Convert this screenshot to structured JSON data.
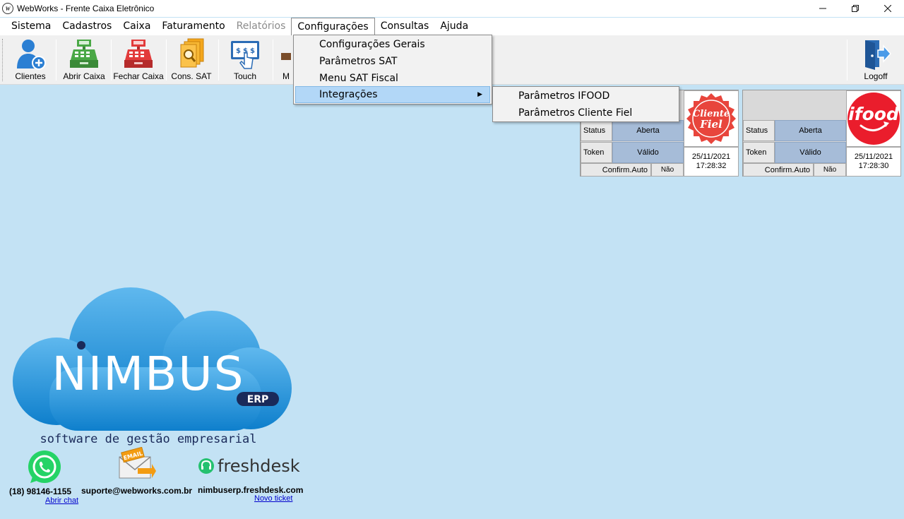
{
  "window": {
    "title": "WebWorks  - Frente Caixa Eletrônico",
    "app_icon": "webworks-logo-icon"
  },
  "menu": [
    {
      "label": "Sistema",
      "enabled": true
    },
    {
      "label": "Cadastros",
      "enabled": true
    },
    {
      "label": "Caixa",
      "enabled": true
    },
    {
      "label": "Faturamento",
      "enabled": true
    },
    {
      "label": "Relatórios",
      "enabled": false
    },
    {
      "label": "Configurações",
      "enabled": true,
      "open": true
    },
    {
      "label": "Consultas",
      "enabled": true
    },
    {
      "label": "Ajuda",
      "enabled": true
    }
  ],
  "toolbar": {
    "clientes": "Clientes",
    "abrir_caixa": "Abrir Caixa",
    "fechar_caixa": "Fechar Caixa",
    "cons_sat": "Cons. SAT",
    "touch": "Touch",
    "partial": "M",
    "logoff": "Logoff"
  },
  "config_menu": [
    "Configurações Gerais",
    "Parâmetros SAT",
    "Menu SAT Fiscal",
    "Integrações"
  ],
  "integracoes_submenu": [
    "Parâmetros IFOOD",
    "Parâmetros Cliente Fiel"
  ],
  "panel_cliente_fiel": {
    "status_label": "Status",
    "status_value": "Aberta",
    "token_label": "Token",
    "token_value": "Válido",
    "confirm_label": "Confirm.Auto",
    "confirm_value": "Não",
    "date": "25/11/2021",
    "time": "17:28:32",
    "logo_text_1": "Cliente",
    "logo_text_2": "Fiel"
  },
  "panel_ifood": {
    "status_label": "Status",
    "status_value": "Aberta",
    "token_label": "Token",
    "token_value": "Válido",
    "confirm_label": "Confirm.Auto",
    "confirm_value": "Não",
    "date": "25/11/2021",
    "time": "17:28:30",
    "logo_text": "ifood"
  },
  "branding": {
    "name": "NIMBUS",
    "badge": "ERP",
    "tagline": "software de gestão empresarial"
  },
  "contacts": {
    "phone": "(18) 98146-1155",
    "chat_link": "Abrir chat",
    "email": "suporte@webworks.com.br",
    "email_badge": "EMAIL",
    "freshdesk_name": "freshdesk",
    "freshdesk_url": "nimbuserp.freshdesk.com",
    "ticket_link": "Novo ticket"
  },
  "colors": {
    "background": "#c3e2f4",
    "menu_highlight": "#b2d7f7",
    "ifood_red": "#ea1d2c",
    "cliente_fiel_red": "#e8453c",
    "nimbus_blue": "#1a8fd8"
  }
}
